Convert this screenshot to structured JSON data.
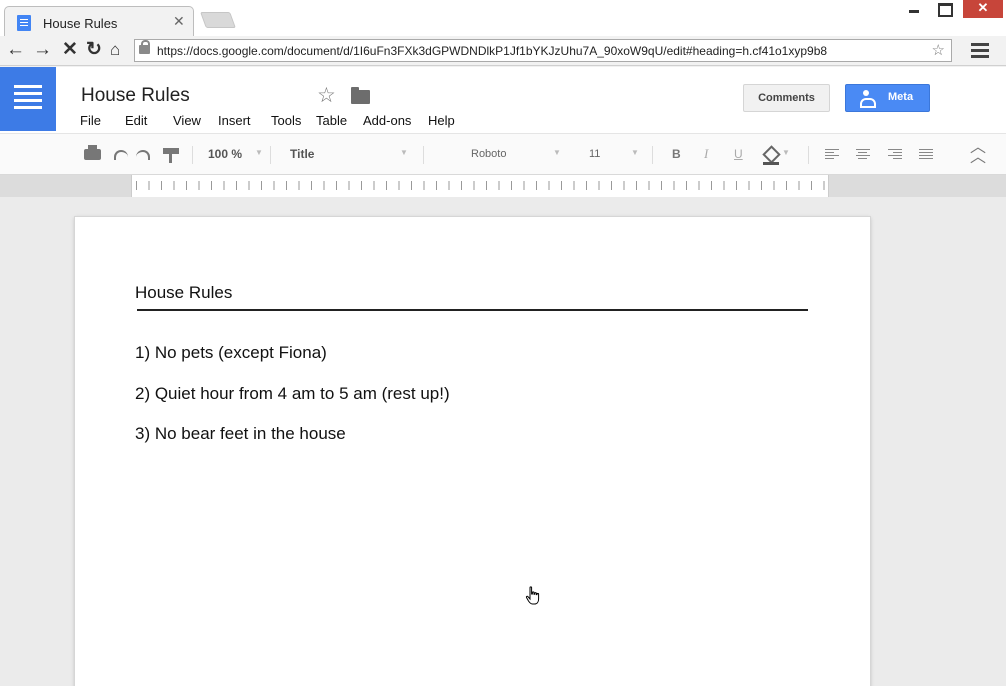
{
  "browser": {
    "tab_title": "House Rules",
    "url": "https://docs.google.com/document/d/1I6uFn3FXk3dGPWDNDlkP1Jf1bYKJzUhu7A_90xoW9qU/edit#heading=h.cf41o1xyp9b8"
  },
  "docs": {
    "title": "House Rules",
    "menu": [
      "File",
      "Edit",
      "View",
      "Insert",
      "Tools",
      "Table",
      "Add-ons",
      "Help"
    ],
    "comments_label": "Comments",
    "share_label": "Meta"
  },
  "toolbar": {
    "zoom": "100 %",
    "style": "Title",
    "font": "Roboto",
    "size": "11",
    "bold": "B",
    "italic": "I",
    "underline": "U"
  },
  "document": {
    "heading": "House Rules",
    "rules": [
      "1) No pets (except Fiona)",
      "2) Quiet hour from 4 am to 5 am (rest up!)",
      "3) No bear feet in the house"
    ]
  },
  "colors": {
    "brand_blue": "#3d7be6",
    "share_blue": "#4a8af4",
    "close_red": "#c7453a"
  }
}
